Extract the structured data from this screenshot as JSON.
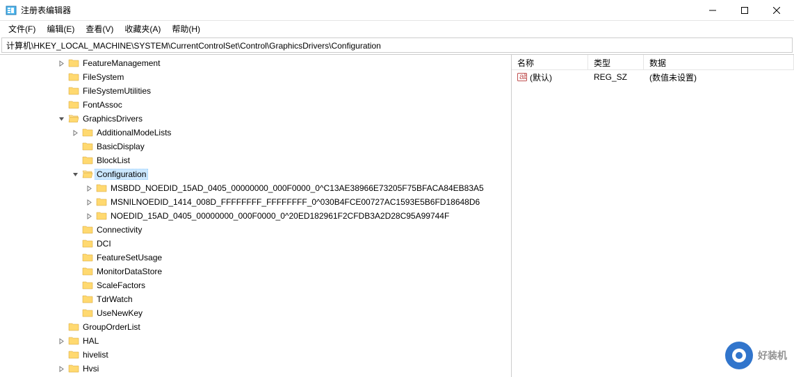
{
  "window": {
    "title": "注册表编辑器"
  },
  "menus": {
    "file": "文件(F)",
    "edit": "编辑(E)",
    "view": "查看(V)",
    "favorites": "收藏夹(A)",
    "help": "帮助(H)"
  },
  "addressbar": {
    "path": "计算机\\HKEY_LOCAL_MACHINE\\SYSTEM\\CurrentControlSet\\Control\\GraphicsDrivers\\Configuration"
  },
  "tree": {
    "items": [
      {
        "indent": 4,
        "expand": ">",
        "label": "FeatureManagement"
      },
      {
        "indent": 4,
        "expand": "",
        "label": "FileSystem"
      },
      {
        "indent": 4,
        "expand": "",
        "label": "FileSystemUtilities"
      },
      {
        "indent": 4,
        "expand": "",
        "label": "FontAssoc"
      },
      {
        "indent": 4,
        "expand": "v",
        "label": "GraphicsDrivers",
        "open": true
      },
      {
        "indent": 5,
        "expand": ">",
        "label": "AdditionalModeLists"
      },
      {
        "indent": 5,
        "expand": "",
        "label": "BasicDisplay"
      },
      {
        "indent": 5,
        "expand": "",
        "label": "BlockList"
      },
      {
        "indent": 5,
        "expand": "v",
        "label": "Configuration",
        "selected": true,
        "open": true
      },
      {
        "indent": 6,
        "expand": ">",
        "label": "MSBDD_NOEDID_15AD_0405_00000000_000F0000_0^C13AE38966E73205F75BFACA84EB83A5"
      },
      {
        "indent": 6,
        "expand": ">",
        "label": "MSNILNOEDID_1414_008D_FFFFFFFF_FFFFFFFF_0^030B4FCE00727AC1593E5B6FD18648D6"
      },
      {
        "indent": 6,
        "expand": ">",
        "label": "NOEDID_15AD_0405_00000000_000F0000_0^20ED182961F2CFDB3A2D28C95A99744F"
      },
      {
        "indent": 5,
        "expand": "",
        "label": "Connectivity"
      },
      {
        "indent": 5,
        "expand": "",
        "label": "DCI"
      },
      {
        "indent": 5,
        "expand": "",
        "label": "FeatureSetUsage"
      },
      {
        "indent": 5,
        "expand": "",
        "label": "MonitorDataStore"
      },
      {
        "indent": 5,
        "expand": "",
        "label": "ScaleFactors"
      },
      {
        "indent": 5,
        "expand": "",
        "label": "TdrWatch"
      },
      {
        "indent": 5,
        "expand": "",
        "label": "UseNewKey"
      },
      {
        "indent": 4,
        "expand": "",
        "label": "GroupOrderList"
      },
      {
        "indent": 4,
        "expand": ">",
        "label": "HAL"
      },
      {
        "indent": 4,
        "expand": "",
        "label": "hivelist"
      },
      {
        "indent": 4,
        "expand": ">",
        "label": "Hvsi"
      }
    ]
  },
  "list": {
    "headers": {
      "name": "名称",
      "type": "类型",
      "data": "数据"
    },
    "rows": [
      {
        "name": "(默认)",
        "type": "REG_SZ",
        "data": "(数值未设置)"
      }
    ]
  },
  "watermark": {
    "text": "好装机"
  }
}
